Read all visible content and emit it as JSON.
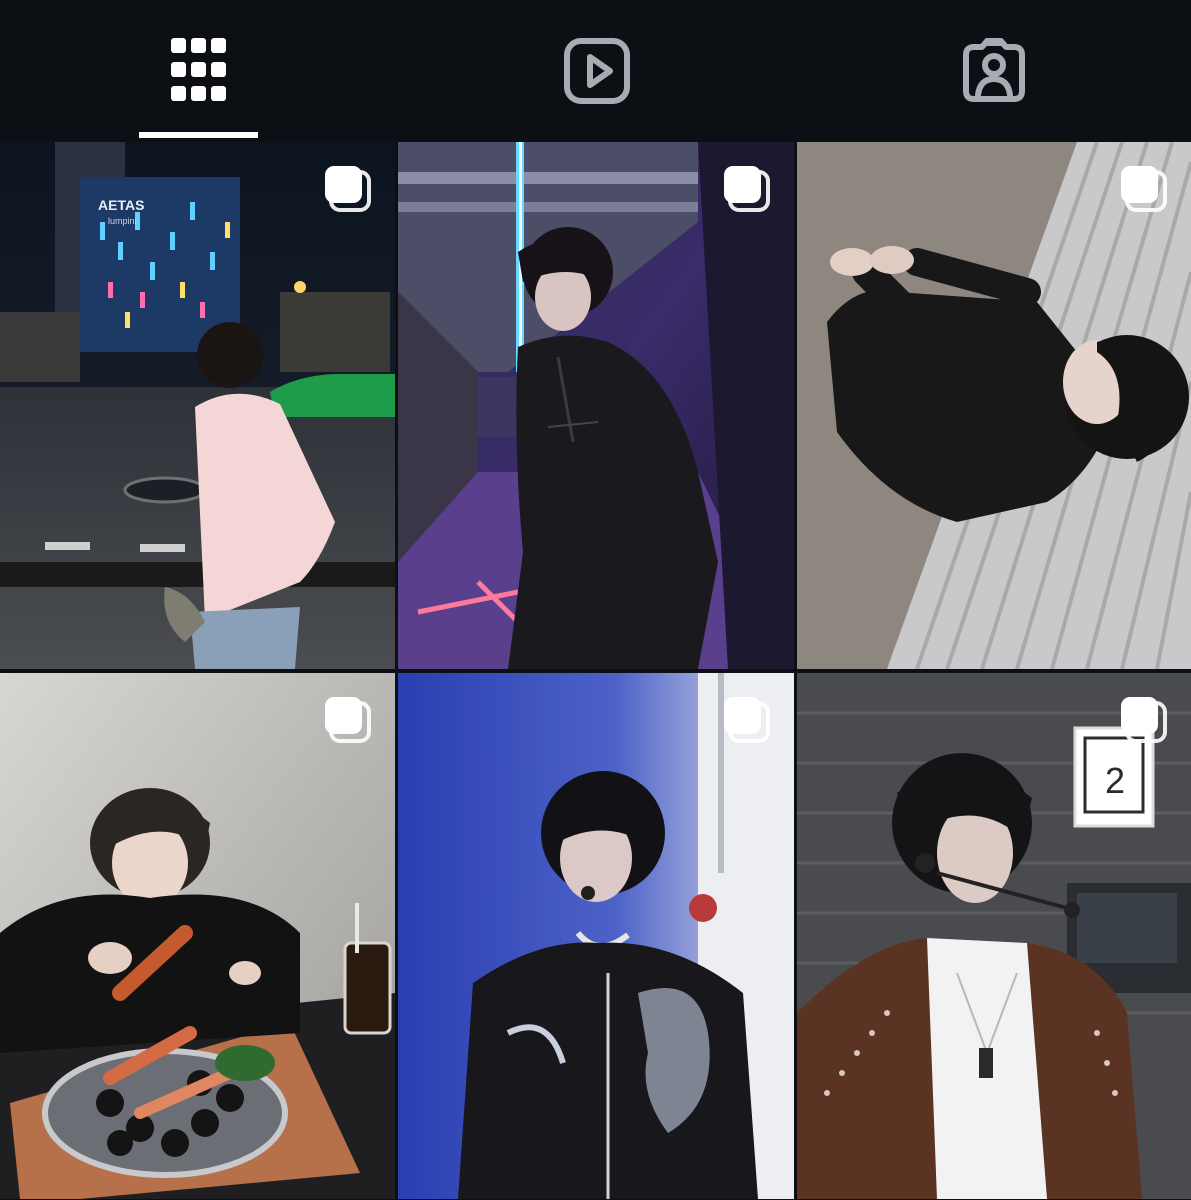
{
  "tabs": [
    {
      "id": "posts",
      "icon": "grid-icon",
      "active": true
    },
    {
      "id": "reels",
      "icon": "reels-icon",
      "active": false
    },
    {
      "id": "tagged",
      "icon": "tagged-person-icon",
      "active": false
    }
  ],
  "colors": {
    "background": "#0c0f14",
    "icon_active": "#ffffff",
    "icon_inactive": "#a8abb2",
    "indicator": "#ffffff"
  },
  "posts": [
    {
      "id": "post-1",
      "multi_icon": "multiple-photos-icon",
      "sign_text": "AETAS",
      "sign_subtext": "lumpini"
    },
    {
      "id": "post-2",
      "multi_icon": "multiple-photos-icon"
    },
    {
      "id": "post-3",
      "multi_icon": "multiple-photos-icon"
    },
    {
      "id": "post-4",
      "multi_icon": "multiple-photos-icon"
    },
    {
      "id": "post-5",
      "multi_icon": "multiple-photos-icon"
    },
    {
      "id": "post-6",
      "multi_icon": "multiple-photos-icon",
      "sign_number": "2"
    }
  ]
}
